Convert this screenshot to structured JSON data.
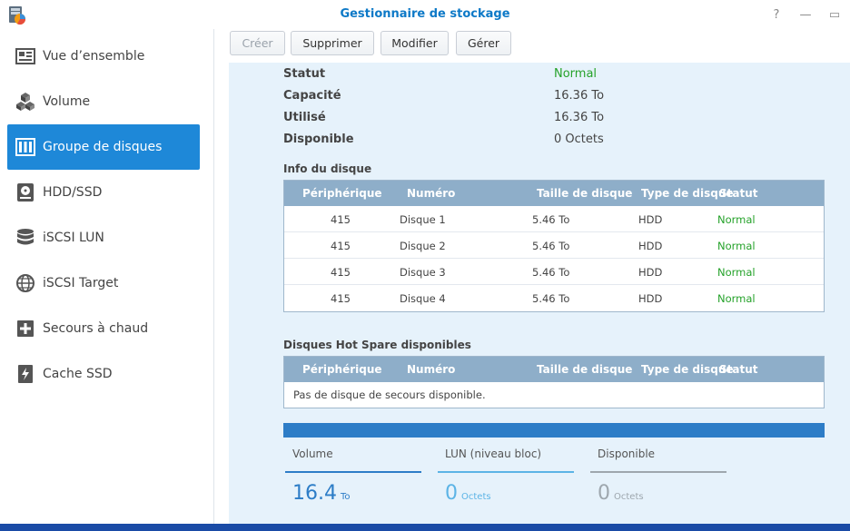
{
  "window": {
    "title": "Gestionnaire de stockage",
    "controls": {
      "help": "?",
      "minimize": "—",
      "maximize": "▭"
    }
  },
  "sidebar": {
    "items": [
      {
        "label": "Vue d’ensemble",
        "icon": "overview-icon"
      },
      {
        "label": "Volume",
        "icon": "volume-cubes-icon"
      },
      {
        "label": "Groupe de disques",
        "icon": "disk-group-icon",
        "active": true
      },
      {
        "label": "HDD/SSD",
        "icon": "hdd-icon"
      },
      {
        "label": "iSCSI LUN",
        "icon": "database-icon"
      },
      {
        "label": "iSCSI Target",
        "icon": "globe-icon"
      },
      {
        "label": "Secours à chaud",
        "icon": "hot-spare-icon"
      },
      {
        "label": "Cache SSD",
        "icon": "ssd-cache-icon"
      }
    ]
  },
  "toolbar": {
    "create": "Créer",
    "delete": "Supprimer",
    "modify": "Modifier",
    "manage": "Gérer"
  },
  "details": {
    "status_label": "Statut",
    "status_value": "Normal",
    "capacity_label": "Capacité",
    "capacity_value": "16.36 To",
    "used_label": "Utilisé",
    "used_value": "16.36 To",
    "available_label": "Disponible",
    "available_value": "0 Octets"
  },
  "disk_info": {
    "title": "Info du disque",
    "headers": [
      "Périphérique",
      "Numéro",
      "Taille de disque",
      "Type de disque",
      "Statut"
    ],
    "rows": [
      [
        "415",
        "Disque 1",
        "5.46 To",
        "HDD",
        "Normal"
      ],
      [
        "415",
        "Disque 2",
        "5.46 To",
        "HDD",
        "Normal"
      ],
      [
        "415",
        "Disque 3",
        "5.46 To",
        "HDD",
        "Normal"
      ],
      [
        "415",
        "Disque 4",
        "5.46 To",
        "HDD",
        "Normal"
      ]
    ]
  },
  "hot_spare": {
    "title": "Disques Hot Spare disponibles",
    "headers": [
      "Périphérique",
      "Numéro",
      "Taille de disque",
      "Type de disque",
      "Statut"
    ],
    "empty_text": "Pas de disque de secours disponible."
  },
  "summary": {
    "volume": {
      "label": "Volume",
      "value": "16.4",
      "unit": "To",
      "color": "#2d7dc7"
    },
    "lun": {
      "label": "LUN (niveau bloc)",
      "value": "0",
      "unit": "Octets",
      "color": "#5cb4e6"
    },
    "available": {
      "label": "Disponible",
      "value": "0",
      "unit": "Octets",
      "color": "#9ea7ae"
    }
  }
}
